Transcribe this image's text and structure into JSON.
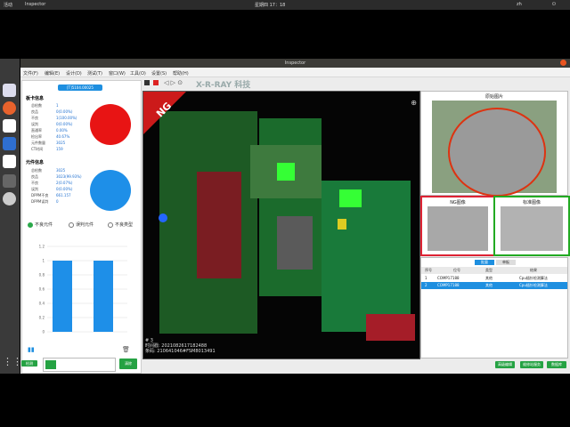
{
  "sysbar": {
    "left": "活动",
    "app": "Inspector",
    "clock": "星期四 17：18",
    "input": "zh"
  },
  "window": {
    "title": "Inspector"
  },
  "menu": [
    "文件(F)",
    "编辑(E)",
    "设计(D)",
    "测试(T)",
    "窗口(W)",
    "工具(O)",
    "设置(S)",
    "帮助(H)"
  ],
  "watermark": "X-R-RAY 科技",
  "left": {
    "chip": "[T]5104.00025",
    "board_title": "板卡信息",
    "board_kv": [
      {
        "k": "总检数",
        "v": "1"
      },
      {
        "k": "良品",
        "v": "0(0.00%)"
      },
      {
        "k": "不良",
        "v": "1(100.00%)"
      },
      {
        "k": "误判",
        "v": "0(0.00%)"
      },
      {
        "k": "直通率",
        "v": "0.00%"
      },
      {
        "k": "检出率",
        "v": "40.67%"
      },
      {
        "k": "元件数量",
        "v": "3025"
      },
      {
        "k": "CT时间",
        "v": "159"
      }
    ],
    "comp_title": "元件信息",
    "comp_kv": [
      {
        "k": "总检数",
        "v": "3025"
      },
      {
        "k": "良品",
        "v": "3023(99.93%)"
      },
      {
        "k": "不良",
        "v": "2(0.07%)"
      },
      {
        "k": "误判",
        "v": "0(0.00%)"
      },
      {
        "k": "DPPM不良",
        "v": "661.157"
      },
      {
        "k": "DPPM误判",
        "v": "0"
      }
    ],
    "radios": [
      {
        "label": "不良元件",
        "on": true
      },
      {
        "label": "误判元件",
        "on": false
      },
      {
        "label": "不良类型",
        "on": false
      }
    ],
    "bottom_left": "检测",
    "bottom_right": "清除"
  },
  "board": {
    "ng": "NG",
    "line1": "# 3",
    "line2": "时间戳: 2021082617182488",
    "line3": "条码: 210641046#FSM8013491"
  },
  "right": {
    "ref_title": "原始图片",
    "ng_title": "NG图像",
    "std_title": "标准图像",
    "tabs": [
      "批量",
      "单板"
    ],
    "cols": [
      "序号",
      "位号",
      "类型",
      "结果"
    ],
    "rows": [
      {
        "n": "1",
        "id": "COMP17188",
        "type": "其他",
        "res": "Cpu插针检测算法",
        "sel": false
      },
      {
        "n": "2",
        "id": "COMP17188",
        "type": "其他",
        "res": "Cpu插针检测算法",
        "sel": true
      }
    ],
    "buttons": [
      "高级编辑",
      "维修站服务",
      "数据库"
    ]
  },
  "chart_data": {
    "type": "bar",
    "categories": [
      "",
      ""
    ],
    "values": [
      1,
      1
    ],
    "ylim": [
      0,
      1.2
    ],
    "yticks": [
      "0",
      "0.2",
      "0.4",
      "0.6",
      "0.8",
      "1",
      "1.2"
    ]
  }
}
